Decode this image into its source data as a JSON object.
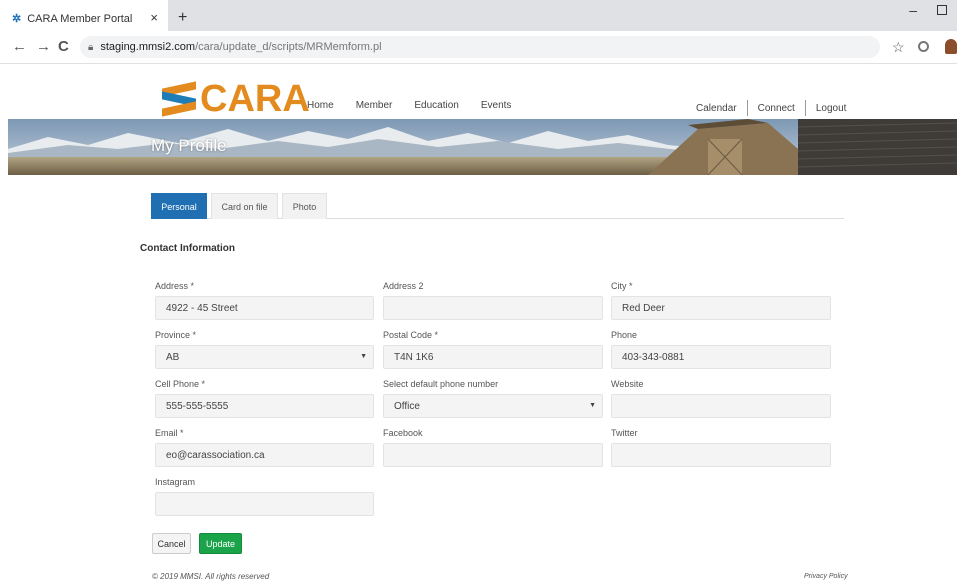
{
  "browser": {
    "tab_title": "CARA Member Portal",
    "tab_close": "×",
    "new_tab": "+",
    "url_host": "staging.mmsi2.com",
    "url_path": "/cara/update_d/scripts/MRMemform.pl",
    "back": "←",
    "forward": "→",
    "reload": "C",
    "star": "☆"
  },
  "site": {
    "logo_text": "CARA",
    "nav": [
      "Home",
      "Member",
      "Education",
      "Events"
    ],
    "util_nav": [
      "Calendar",
      "Connect",
      "Logout"
    ],
    "page_title": "My Profile"
  },
  "tabs": [
    {
      "label": "Personal",
      "active": true
    },
    {
      "label": "Card on file",
      "active": false
    },
    {
      "label": "Photo",
      "active": false
    }
  ],
  "section_title": "Contact Information",
  "fields": {
    "address": {
      "label": "Address *",
      "value": "4922 - 45 Street"
    },
    "address2": {
      "label": "Address 2",
      "value": ""
    },
    "city": {
      "label": "City *",
      "value": "Red Deer"
    },
    "province": {
      "label": "Province *",
      "value": "AB"
    },
    "postal": {
      "label": "Postal Code *",
      "value": "T4N 1K6"
    },
    "phone": {
      "label": "Phone",
      "value": "403-343-0881"
    },
    "cell": {
      "label": "Cell Phone *",
      "value": "555-555-5555"
    },
    "default_phone": {
      "label": "Select default phone number",
      "value": "Office"
    },
    "website": {
      "label": "Website",
      "value": ""
    },
    "email": {
      "label": "Email *",
      "value": "eo@carassociation.ca"
    },
    "facebook": {
      "label": "Facebook",
      "value": ""
    },
    "twitter": {
      "label": "Twitter",
      "value": ""
    },
    "instagram": {
      "label": "Instagram",
      "value": ""
    }
  },
  "buttons": {
    "cancel": "Cancel",
    "update": "Update"
  },
  "footer": {
    "copyright": "© 2019 MMSI. All rights reserved",
    "privacy": "Privacy Policy"
  },
  "colors": {
    "brand_orange": "#e38b1e",
    "brand_blue": "#1e7db6",
    "tab_active": "#1f6fb2",
    "update_green": "#1aa349"
  }
}
